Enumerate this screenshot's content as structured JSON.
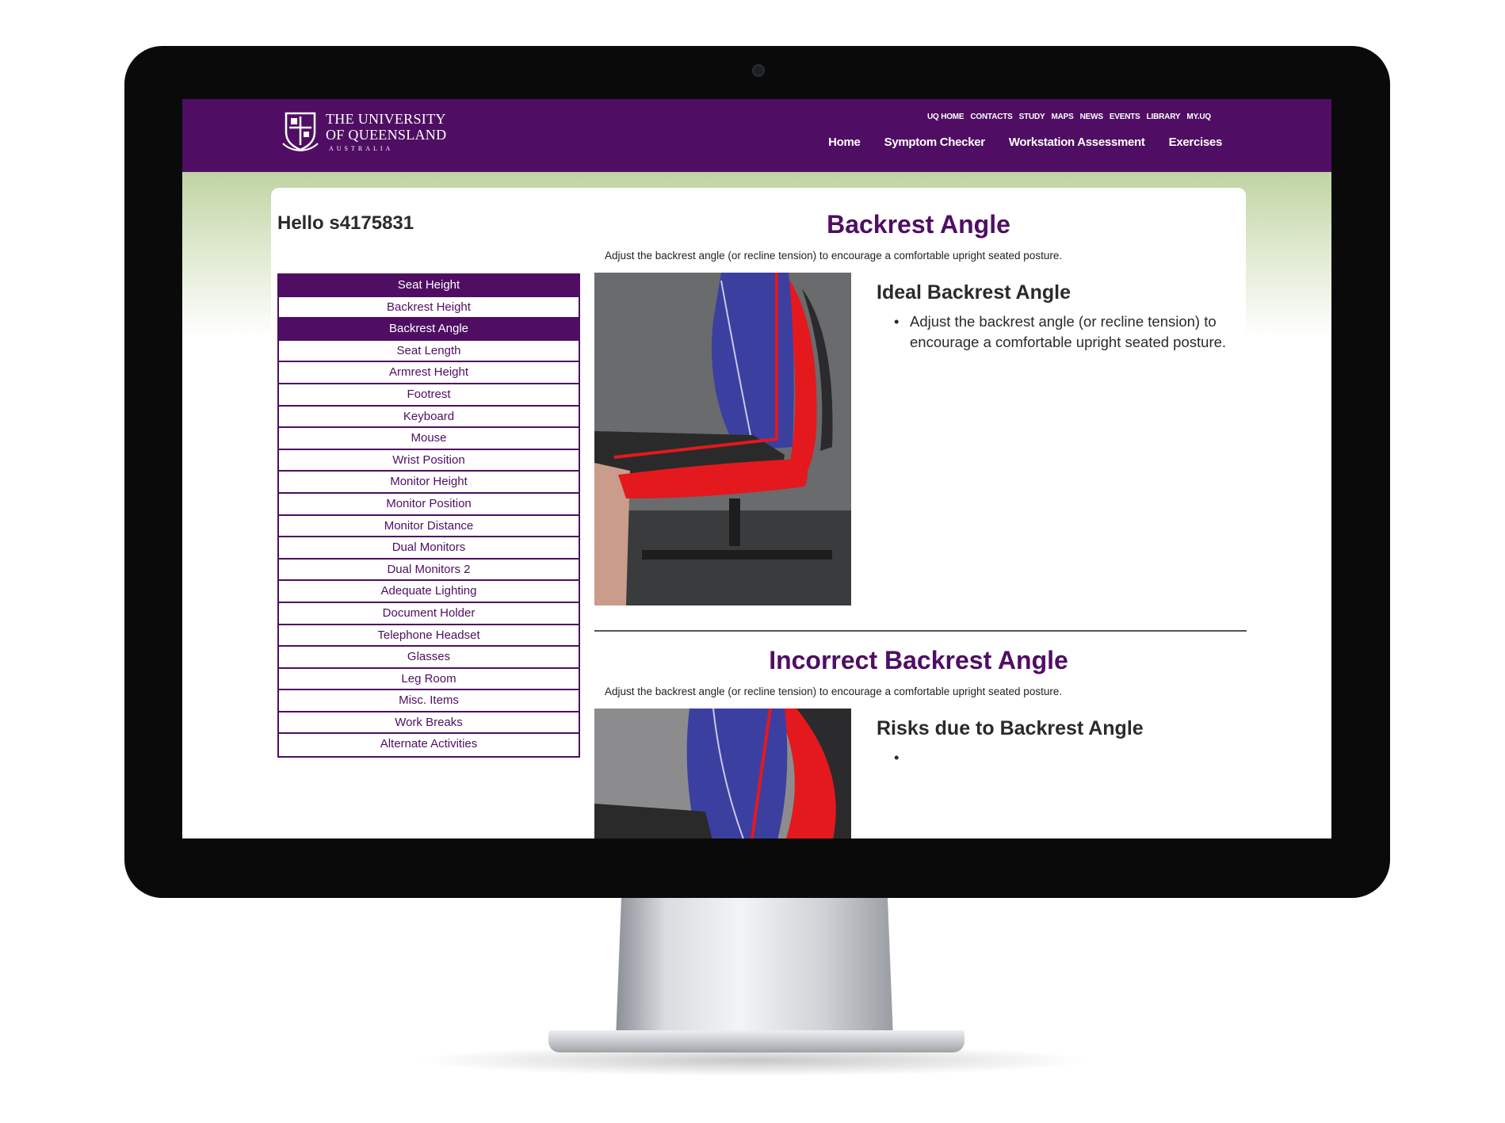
{
  "logo": {
    "line1": "THE UNIVERSITY",
    "line2": "OF QUEENSLAND",
    "line3": "AUSTRALIA"
  },
  "utility_nav": [
    "UQ HOME",
    "CONTACTS",
    "STUDY",
    "MAPS",
    "NEWS",
    "EVENTS",
    "LIBRARY",
    "MY.UQ"
  ],
  "main_nav": [
    "Home",
    "Symptom Checker",
    "Workstation Assessment",
    "Exercises"
  ],
  "greeting": "Hello s4175831",
  "side_menu": [
    {
      "label": "Seat Height",
      "active": true
    },
    {
      "label": "Backrest Height",
      "active": false
    },
    {
      "label": "Backrest Angle",
      "active": true
    },
    {
      "label": "Seat Length",
      "active": false
    },
    {
      "label": "Armrest Height",
      "active": false
    },
    {
      "label": "Footrest",
      "active": false
    },
    {
      "label": "Keyboard",
      "active": false
    },
    {
      "label": "Mouse",
      "active": false
    },
    {
      "label": "Wrist Position",
      "active": false
    },
    {
      "label": "Monitor Height",
      "active": false
    },
    {
      "label": "Monitor Position",
      "active": false
    },
    {
      "label": "Monitor Distance",
      "active": false
    },
    {
      "label": "Dual Monitors",
      "active": false
    },
    {
      "label": "Dual Monitors 2",
      "active": false
    },
    {
      "label": "Adequate Lighting",
      "active": false
    },
    {
      "label": "Document Holder",
      "active": false
    },
    {
      "label": "Telephone Headset",
      "active": false
    },
    {
      "label": "Glasses",
      "active": false
    },
    {
      "label": "Leg Room",
      "active": false
    },
    {
      "label": "Misc. Items",
      "active": false
    },
    {
      "label": "Work Breaks",
      "active": false
    },
    {
      "label": "Alternate Activities",
      "active": false
    }
  ],
  "main": {
    "title": "Backrest Angle",
    "description": "Adjust the backrest angle (or recline tension) to encourage a comfortable upright seated posture.",
    "ideal": {
      "heading": "Ideal Backrest Angle",
      "bullet": "Adjust the backrest angle (or recline tension) to encourage a comfortable upright seated posture."
    },
    "incorrect": {
      "title": "Incorrect Backrest Angle",
      "description": "Adjust the backrest angle (or recline tension) to encourage a comfortable upright seated posture.",
      "heading": "Risks due to Backrest Angle",
      "bullet": ""
    }
  },
  "colors": {
    "brand_purple": "#4f0e63",
    "chair_red": "#e3191e",
    "shirt_blue": "#3b3fa0"
  }
}
